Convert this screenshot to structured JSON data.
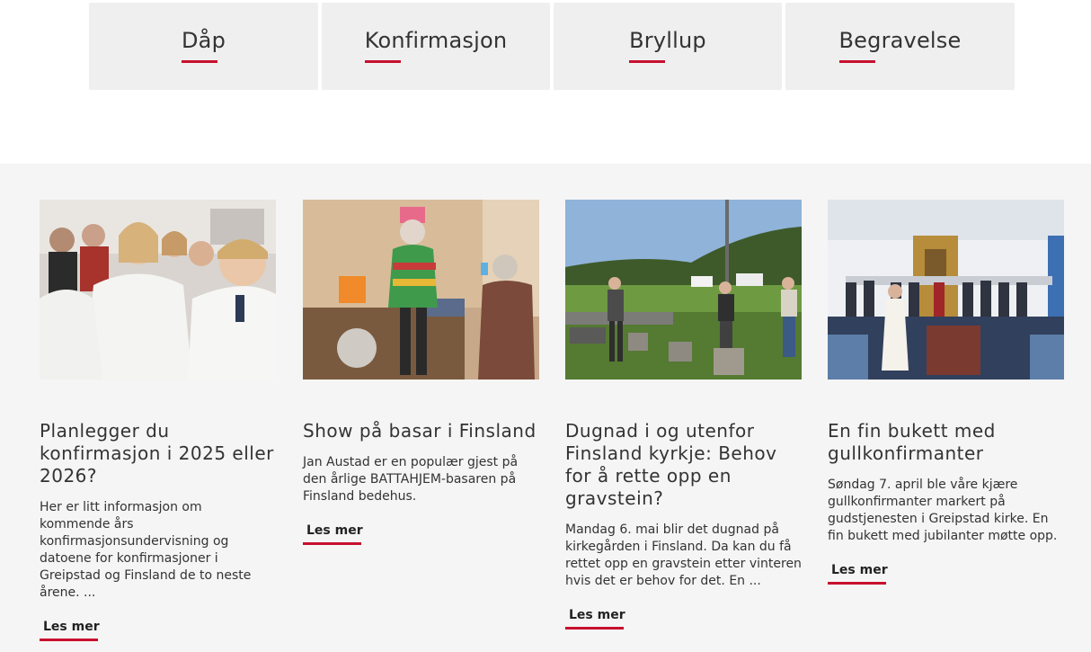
{
  "tiles": [
    {
      "label": "Dåp"
    },
    {
      "label": "Konfirmasjon"
    },
    {
      "label": "Bryllup"
    },
    {
      "label": "Begravelse"
    }
  ],
  "colors": {
    "accent": "#c8102e",
    "tile_bg": "#efefef",
    "band_bg": "#f5f5f5"
  },
  "news": [
    {
      "title": "Planlegger du konfirmasjon i 2025 eller 2026?",
      "text": "Her er litt informasjon om kommende års konfirmasjonsundervisning og datoene for konfirmasjoner i Greipstad og Finsland de to neste årene. ...",
      "read_more": "Les mer"
    },
    {
      "title": "Show på basar i Finsland",
      "text": "Jan Austad er en populær gjest på den årlige BATTAHJEM-basaren på Finsland bedehus.",
      "read_more": "Les mer"
    },
    {
      "title": "Dugnad i og utenfor Finsland kyrkje: Behov for å rette opp en gravstein?",
      "text": "Mandag 6. mai blir det dugnad på kirkegården i Finsland. Da kan du få rettet opp en gravstein etter vinteren hvis det er behov for det. En ...",
      "read_more": "Les mer"
    },
    {
      "title": "En fin bukett med gullkonfirmanter",
      "text": "Søndag 7. april ble våre kjære gullkonfirmanter markert på gudstjenesten i Greipstad kirke. En fin bukett med jubilanter møtte opp.",
      "read_more": "Les mer"
    }
  ]
}
